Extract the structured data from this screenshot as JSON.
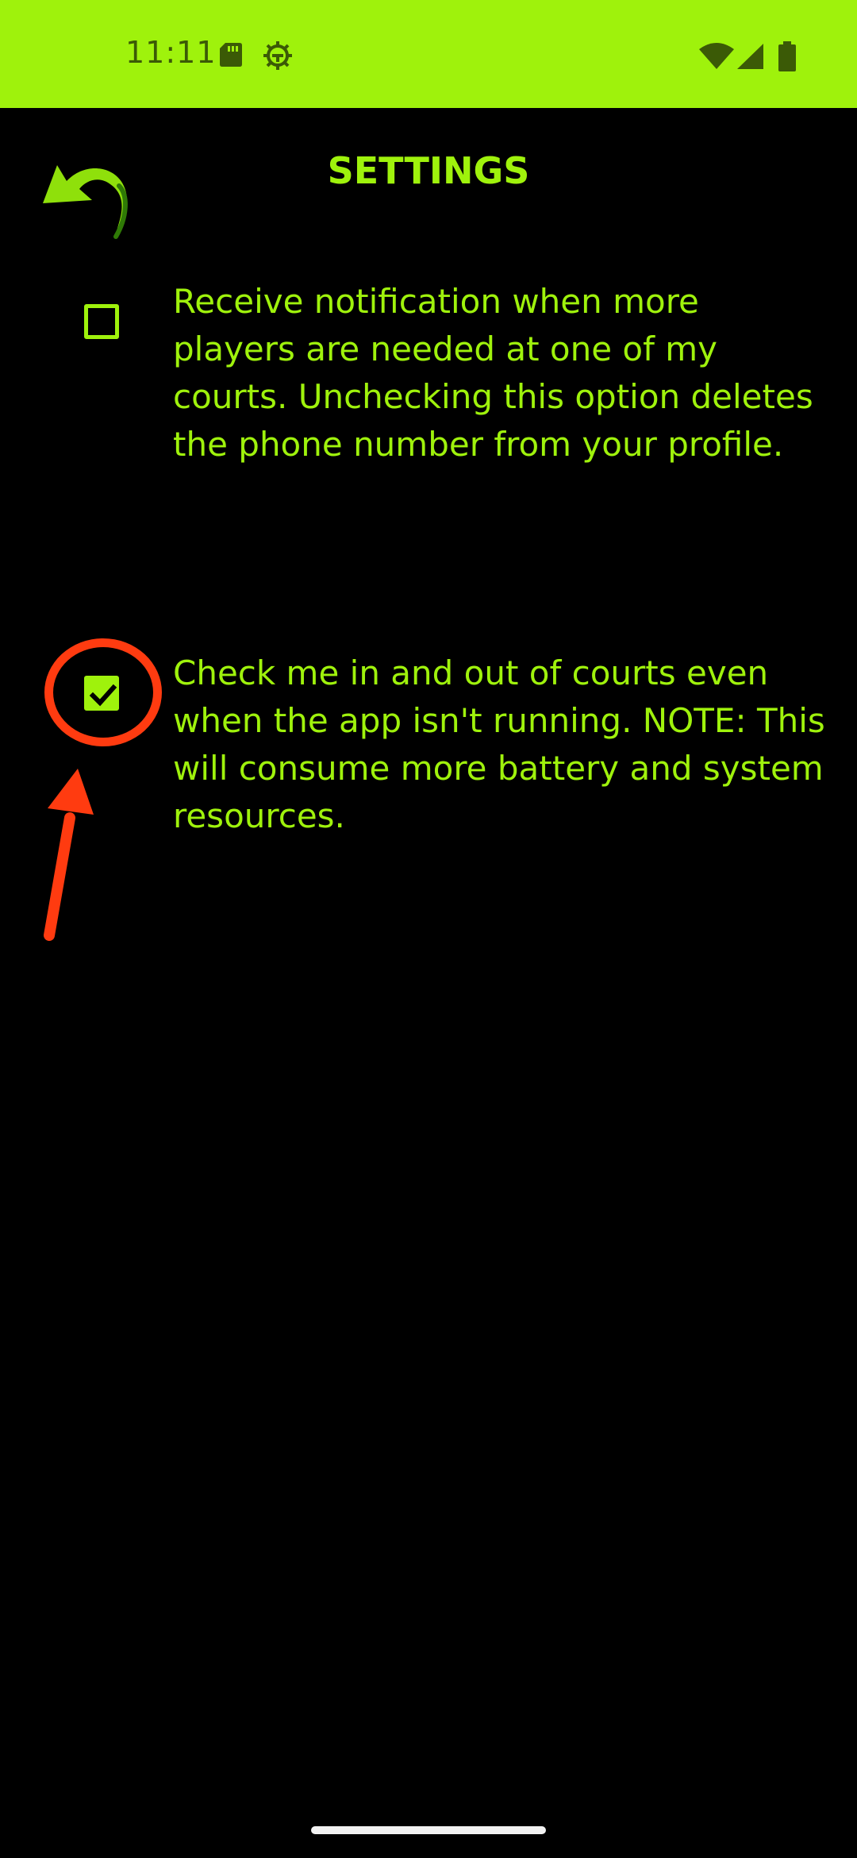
{
  "status_bar": {
    "time": "11:11",
    "background": "#9ff20c",
    "icons": [
      "sd-card-icon",
      "gear-icon",
      "wifi-icon",
      "signal-icon",
      "battery-icon"
    ]
  },
  "header": {
    "title": "SETTINGS",
    "back_icon": "back-arrow-icon"
  },
  "settings": {
    "options": [
      {
        "checked": false,
        "label": "Receive notification when more players are needed at one of my courts. Unchecking this option deletes the phone number from your profile."
      },
      {
        "checked": true,
        "label": "Check me in and out of courts even when the app isn't running. NOTE: This will consume more battery and system resources."
      }
    ]
  },
  "colors": {
    "accent": "#9ff20c",
    "background": "#000000",
    "annotation": "#ff3b10"
  }
}
